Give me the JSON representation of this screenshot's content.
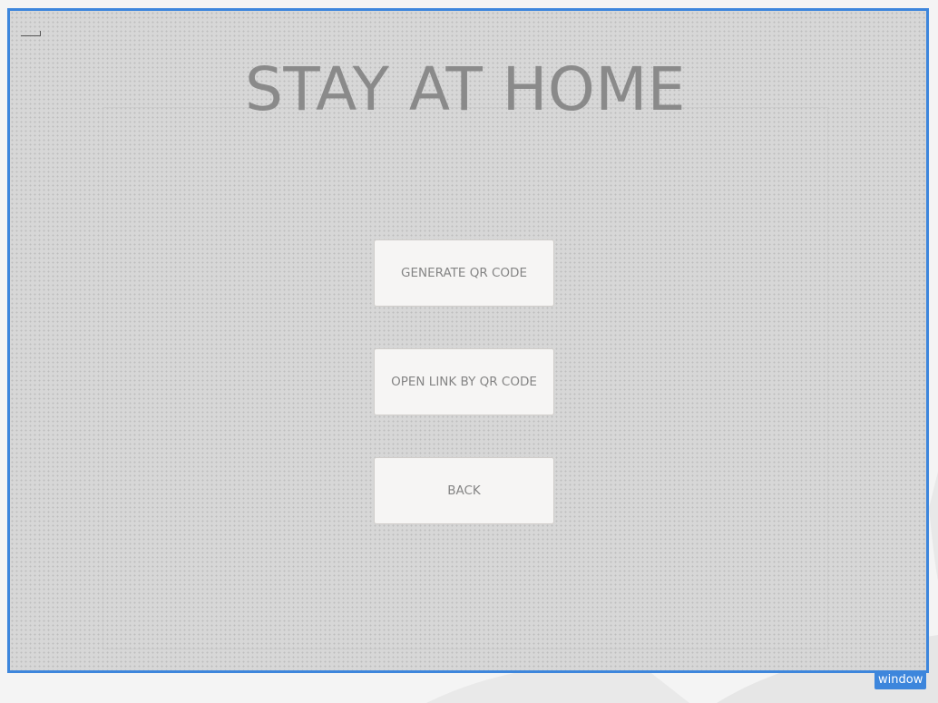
{
  "window": {
    "title": "STAY AT HOME",
    "badge_label": "window",
    "accent_color": "#3d86dc",
    "background_color": "#d7d7d7"
  },
  "buttons": {
    "generate_label": "GENERATE QR CODE",
    "open_link_label": "OPEN LINK BY QR CODE",
    "back_label": "BACK"
  }
}
